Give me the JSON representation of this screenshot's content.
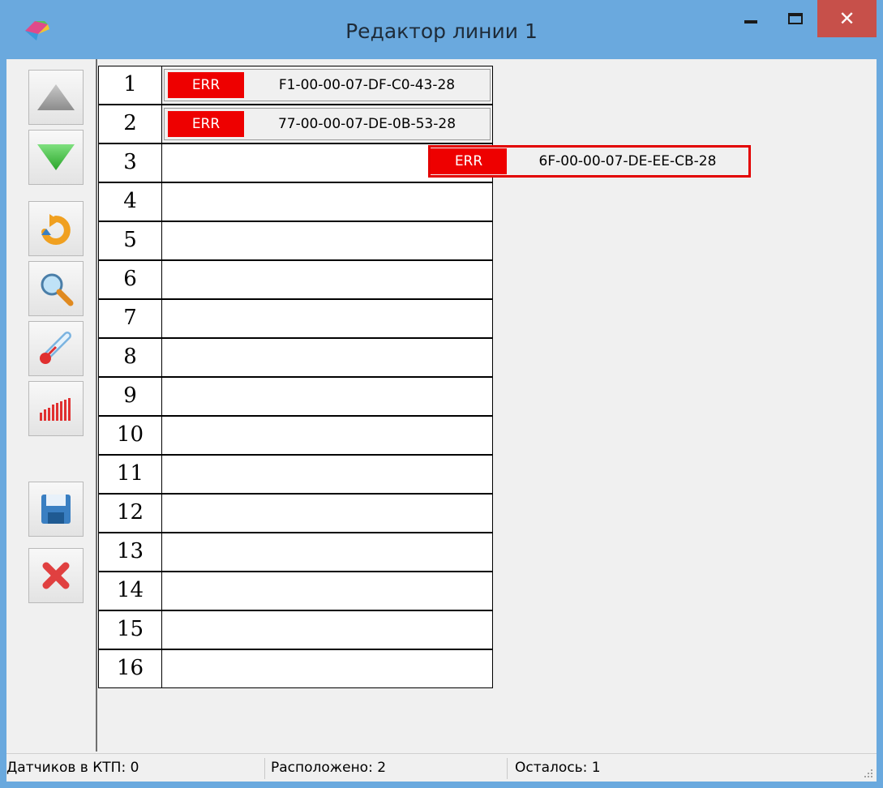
{
  "window": {
    "title": "Редактор линии 1",
    "minimize_icon": "minimize-icon",
    "maximize_icon": "maximize-icon",
    "close_label": "✕"
  },
  "toolbar": {
    "buttons": [
      {
        "name": "move-up-button",
        "icon": "triangle-up-icon",
        "color": "#a7a7a7"
      },
      {
        "name": "move-down-button",
        "icon": "triangle-down-icon",
        "color": "#3fbf3f"
      },
      {
        "name": "reverse-button",
        "icon": "refresh-arrow-icon",
        "color": "#f0a020"
      },
      {
        "name": "search-button",
        "icon": "magnifier-icon",
        "color": "#4a90d9"
      },
      {
        "name": "temperature-button",
        "icon": "thermometer-icon",
        "color": "#4a90d9"
      },
      {
        "name": "signal-button",
        "icon": "signal-bars-icon",
        "color": "#e03030"
      },
      {
        "name": "save-button",
        "icon": "floppy-disk-icon",
        "color": "#3a7fc2"
      },
      {
        "name": "delete-button",
        "icon": "red-x-icon",
        "color": "#e04040"
      }
    ]
  },
  "rows": [
    {
      "num": "1",
      "status": "ERR",
      "address": "F1-00-00-07-DF-C0-43-28"
    },
    {
      "num": "2",
      "status": "ERR",
      "address": "77-00-00-07-DE-0B-53-28"
    },
    {
      "num": "3",
      "status": "",
      "address": ""
    },
    {
      "num": "4",
      "status": "",
      "address": ""
    },
    {
      "num": "5",
      "status": "",
      "address": ""
    },
    {
      "num": "6",
      "status": "",
      "address": ""
    },
    {
      "num": "7",
      "status": "",
      "address": ""
    },
    {
      "num": "8",
      "status": "",
      "address": ""
    },
    {
      "num": "9",
      "status": "",
      "address": ""
    },
    {
      "num": "10",
      "status": "",
      "address": ""
    },
    {
      "num": "11",
      "status": "",
      "address": ""
    },
    {
      "num": "12",
      "status": "",
      "address": ""
    },
    {
      "num": "13",
      "status": "",
      "address": ""
    },
    {
      "num": "14",
      "status": "",
      "address": ""
    },
    {
      "num": "15",
      "status": "",
      "address": ""
    },
    {
      "num": "16",
      "status": "",
      "address": ""
    }
  ],
  "dragged_sensor": {
    "status": "ERR",
    "address": "6F-00-00-07-DE-EE-CB-28"
  },
  "status_bar": {
    "sensors_in_ktp": "Датчиков в КТП: 0",
    "placed": "Расположено: 2",
    "remaining": "Осталось: 1"
  },
  "colors": {
    "title_bar": "#6aa9de",
    "close_button": "#c7504a",
    "err_badge": "#ee0000",
    "dragged_border": "#e30000"
  }
}
